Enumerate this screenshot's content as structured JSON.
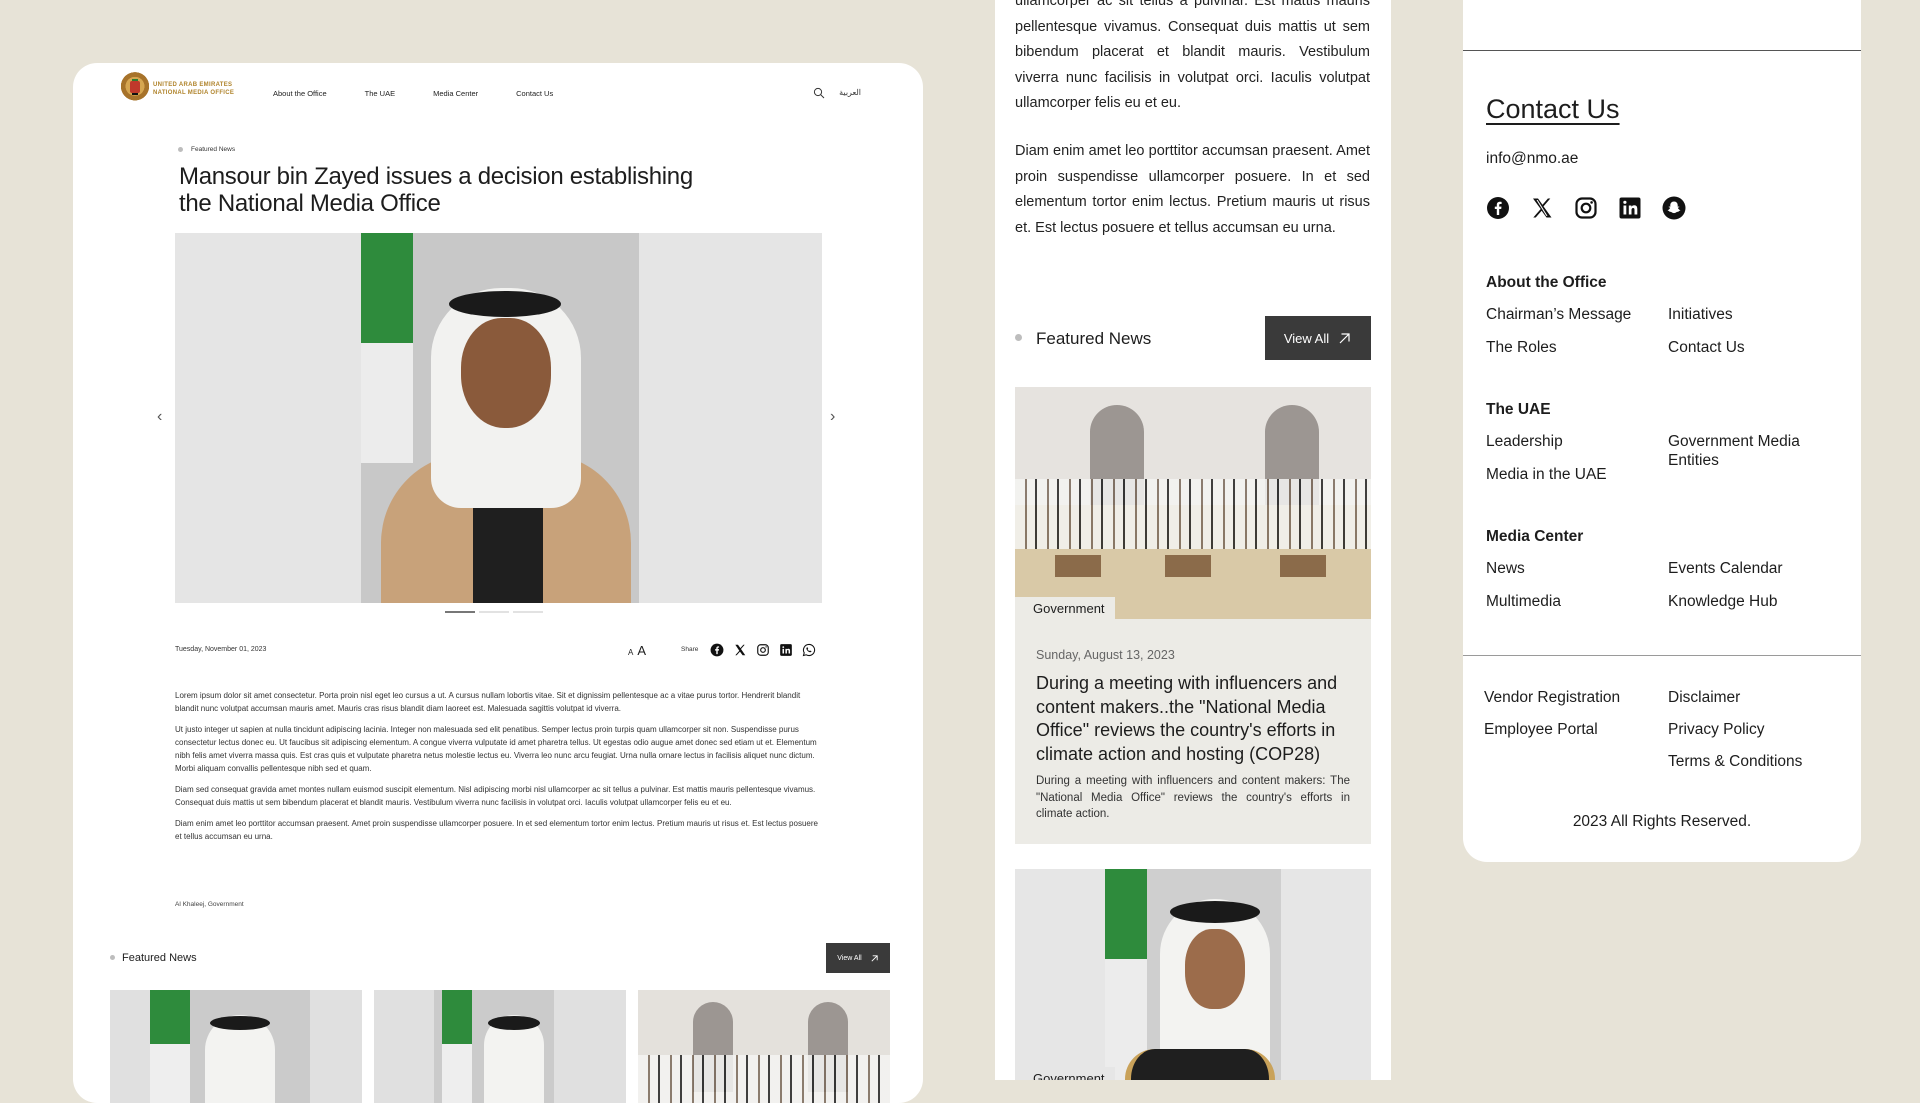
{
  "nav": {
    "logo_line1": "UNITED ARAB EMIRATES",
    "logo_line2": "NATIONAL MEDIA OFFICE",
    "links": [
      "About the Office",
      "The UAE",
      "Media Center",
      "Contact Us"
    ],
    "lang": "العربية"
  },
  "article": {
    "tag": "Featured News",
    "title": "Mansour bin Zayed issues a decision establishing the National Media Office",
    "date": "Tuesday, November 01, 2023",
    "font_small": "A",
    "font_large": "A",
    "share_label": "Share",
    "share_icons": [
      "facebook-icon",
      "x-icon",
      "instagram-icon",
      "linkedin-icon",
      "whatsapp-icon"
    ],
    "paragraphs": [
      "Lorem ipsum dolor sit amet consectetur. Porta proin nisl eget leo cursus a ut. A cursus nullam lobortis vitae. Sit et dignissim pellentesque ac a vitae purus tortor. Hendrerit blandit blandit nunc volutpat accumsan mauris amet. Mauris cras risus blandit diam laoreet est. Malesuada sagittis volutpat id viverra.",
      "Ut justo integer ut sapien at nulla tincidunt adipiscing lacinia. Integer non malesuada sed elit penatibus. Semper lectus proin turpis quam ullamcorper sit non. Suspendisse purus consectetur lectus donec eu. Ut faucibus sit adipiscing elementum. A congue viverra vulputate id amet pharetra tellus. Ut egestas odio augue amet donec sed etiam ut et. Elementum nibh felis amet viverra massa quis. Est cras quis et vulputate pharetra netus molestie lectus eu. Viverra leo nunc arcu feugiat. Urna nulla ornare lectus in facilisis aliquet nunc dictum. Morbi aliquam convallis pellentesque nibh sed et quam.",
      "Diam sed consequat gravida amet montes nullam euismod suscipit elementum. Nisl adipiscing morbi nisl ullamcorper ac sit tellus a pulvinar. Est mattis mauris pellentesque vivamus. Consequat duis mattis ut sem bibendum placerat et blandit mauris. Vestibulum viverra nunc facilisis in volutpat orci. Iaculis volutpat ullamcorper felis eu et eu.",
      "Diam enim amet leo porttitor accumsan praesent. Amet proin suspendisse ullamcorper posuere. In et sed elementum tortor enim lectus. Pretium mauris ut risus et. Est lectus posuere et tellus accumsan eu urna."
    ],
    "source": "Al Khaleej, Government"
  },
  "featured_section": {
    "label": "Featured News",
    "view_all": "View All"
  },
  "panel2": {
    "text_top": "ullamcorper ac sit tellus a pulvinar. Est mattis mauris pellentesque vivamus. Consequat duis mattis ut sem bibendum placerat et blandit mauris. Vestibulum viverra nunc facilisis in volutpat orci. Iaculis volutpat ullamcorper felis eu et eu.",
    "text_second": "Diam enim amet leo porttitor accumsan praesent. Amet proin suspendisse ullamcorper posuere. In et sed elementum tortor enim lectus. Pretium mauris ut risus et. Est lectus posuere et tellus accumsan eu urna.",
    "card1": {
      "category": "Government",
      "date": "Sunday, August 13, 2023",
      "title": "During a meeting with influencers and content makers..the \"National Media Office\" reviews the country's efforts in climate action and hosting (COP28)",
      "desc": "During a meeting with influencers and content makers: The \"National Media Office\" reviews the country's efforts in climate action."
    },
    "card2": {
      "category": "Government"
    }
  },
  "footer": {
    "contact_title": "Contact Us",
    "email": "info@nmo.ae",
    "social_icons": [
      "facebook-icon",
      "x-icon",
      "instagram-icon",
      "linkedin-icon",
      "snapchat-icon"
    ],
    "sections": [
      {
        "title": "About the Office",
        "links": [
          "Chairman’s Message",
          "Initiatives",
          "The Roles",
          "Contact Us"
        ]
      },
      {
        "title": "The UAE",
        "links": [
          "Leadership",
          "Government Media Entities",
          "Media in the UAE"
        ]
      },
      {
        "title": "Media Center",
        "links": [
          "News",
          "Events Calendar",
          "Multimedia",
          "Knowledge Hub"
        ]
      }
    ],
    "bottom_links": [
      "Vendor Registration",
      "Disclaimer",
      "Employee Portal",
      "Privacy Policy",
      "Terms & Conditions"
    ],
    "copyright": "2023 All Rights Reserved."
  }
}
